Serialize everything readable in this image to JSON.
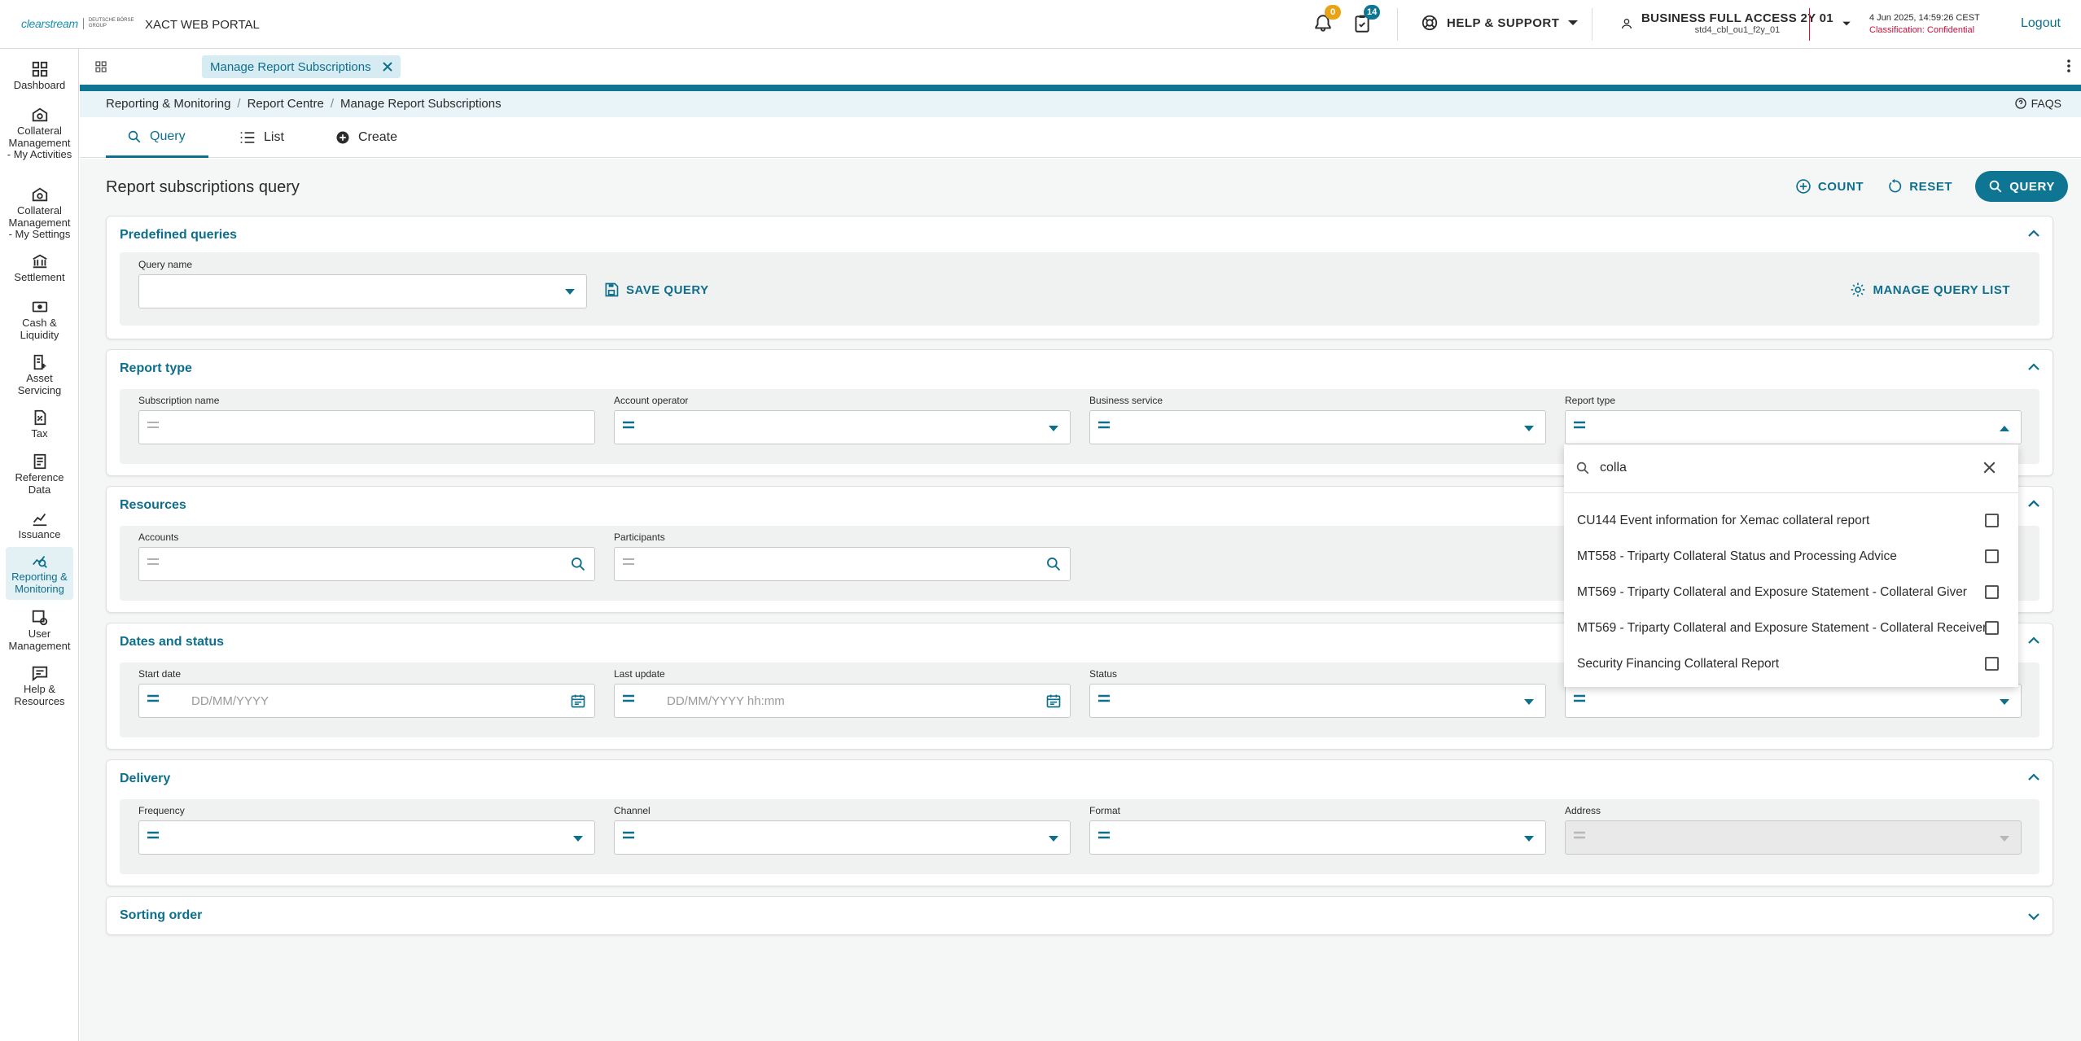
{
  "header": {
    "logo_brand": "clearstream",
    "logo_group": "DEUTSCHE BÖRSE GROUP",
    "portal_title": "XACT WEB PORTAL",
    "notifications_count": "0",
    "tasks_count": "14",
    "help_label": "HELP & SUPPORT",
    "user_name": "BUSINESS FULL ACCESS 2Y 01",
    "user_id": "std4_cbl_ou1_f2y_01",
    "datetime": "4 Jun 2025, 14:59:26 CEST",
    "classification": "Classification: Confidential",
    "logout": "Logout",
    "colors": {
      "accent": "#0e6f8d",
      "badge_orange": "#e8a317",
      "badge_teal": "#0e7693",
      "classification": "#d0103a"
    }
  },
  "sidebar": {
    "items": [
      {
        "label": "Dashboard",
        "icon": "dashboard-icon"
      },
      {
        "label": "Collateral Management - My Activities",
        "icon": "collateral-activities-icon"
      },
      {
        "label": "Collateral Management - My Settings",
        "icon": "collateral-settings-icon"
      },
      {
        "label": "Settlement",
        "icon": "bank-icon"
      },
      {
        "label": "Cash & Liquidity",
        "icon": "cash-icon"
      },
      {
        "label": "Asset Servicing",
        "icon": "asset-servicing-icon"
      },
      {
        "label": "Tax",
        "icon": "tax-icon"
      },
      {
        "label": "Reference Data",
        "icon": "reference-data-icon"
      },
      {
        "label": "Issuance",
        "icon": "issuance-chart-icon"
      },
      {
        "label": "Reporting & Monitoring",
        "icon": "reporting-icon"
      },
      {
        "label": "User Management",
        "icon": "user-management-icon"
      },
      {
        "label": "Help & Resources",
        "icon": "help-resources-icon"
      }
    ]
  },
  "tabstrip": {
    "open_tab": "Manage Report Subscriptions"
  },
  "breadcrumb": {
    "items": [
      "Reporting & Monitoring",
      "Report Centre",
      "Manage Report Subscriptions"
    ],
    "faqs": "FAQS"
  },
  "tabs": [
    {
      "label": "Query",
      "icon": "search-icon"
    },
    {
      "label": "List",
      "icon": "list-icon"
    },
    {
      "label": "Create",
      "icon": "add-circle-icon"
    }
  ],
  "page": {
    "title": "Report subscriptions query",
    "count": "COUNT",
    "reset": "RESET",
    "query": "QUERY"
  },
  "predefined": {
    "title": "Predefined queries",
    "query_name_label": "Query name",
    "save_query": "SAVE QUERY",
    "manage": "MANAGE QUERY LIST"
  },
  "report_type_section": {
    "title": "Report type",
    "labels": [
      "Subscription name",
      "Account operator",
      "Business service",
      "Report type"
    ]
  },
  "resources": {
    "title": "Resources",
    "labels": [
      "Accounts",
      "Participants"
    ]
  },
  "dates": {
    "title": "Dates and status",
    "labels": [
      "Start date",
      "Last update",
      "Status"
    ],
    "start_placeholder": "DD/MM/YYYY",
    "update_placeholder": "DD/MM/YYYY hh:mm"
  },
  "delivery": {
    "title": "Delivery",
    "labels": [
      "Frequency",
      "Channel",
      "Format",
      "Address"
    ]
  },
  "sorting": {
    "title": "Sorting order"
  },
  "dropdown": {
    "search_value": "colla",
    "options": [
      "CU144 Event information for Xemac collateral report",
      "MT558 - Triparty Collateral Status and Processing Advice",
      "MT569 - Triparty Collateral and Exposure Statement - Collateral Giver",
      "MT569 - Triparty Collateral and Exposure Statement - Collateral Receiver",
      "Security Financing Collateral Report"
    ]
  }
}
